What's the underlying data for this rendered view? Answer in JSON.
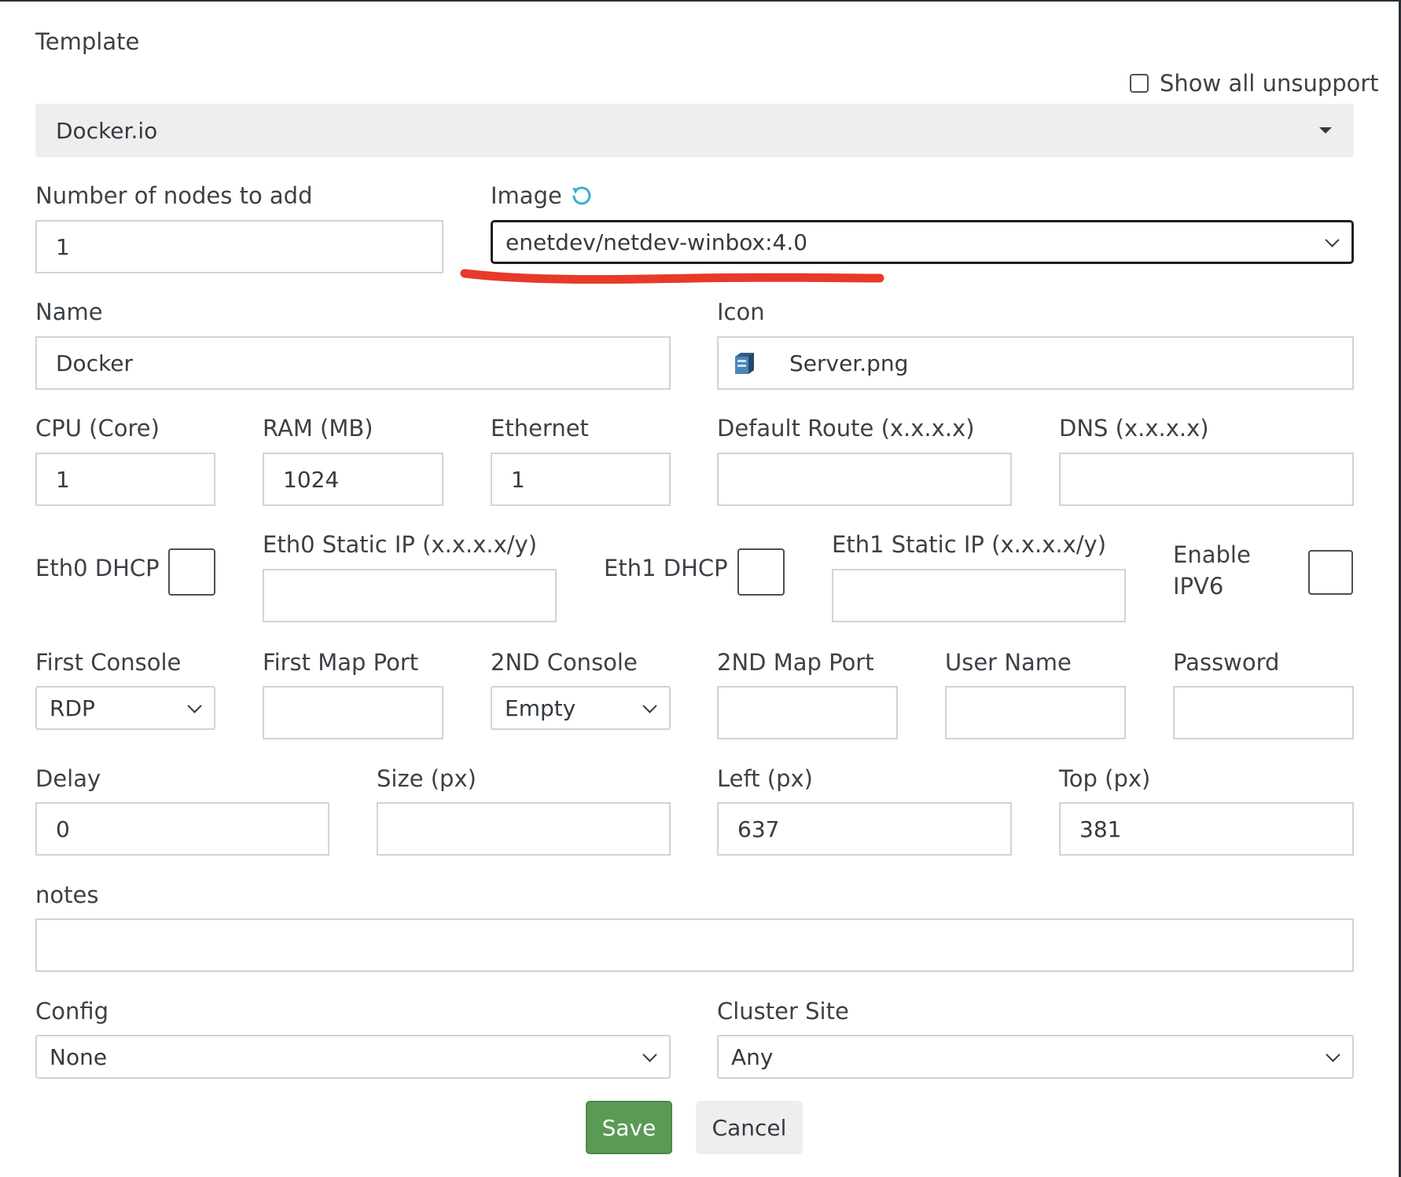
{
  "template": {
    "label": "Template",
    "value": "Docker.io",
    "show_all_label": "Show all unsupport"
  },
  "nodes": {
    "label": "Number of nodes to add",
    "value": "1"
  },
  "image": {
    "label": "Image",
    "value": "enetdev/netdev-winbox:4.0",
    "refresh_icon": "refresh-icon"
  },
  "name": {
    "label": "Name",
    "value": "Docker"
  },
  "icon": {
    "label": "Icon",
    "value": "Server.png",
    "glyph": "server-icon"
  },
  "cpu": {
    "label": "CPU (Core)",
    "value": "1"
  },
  "ram": {
    "label": "RAM (MB)",
    "value": "1024"
  },
  "ethernet": {
    "label": "Ethernet",
    "value": "1"
  },
  "default_route": {
    "label": "Default Route (x.x.x.x)",
    "value": ""
  },
  "dns": {
    "label": "DNS (x.x.x.x)",
    "value": ""
  },
  "eth0_dhcp": {
    "label": "Eth0 DHCP"
  },
  "eth0_ip": {
    "label": "Eth0 Static IP (x.x.x.x/y)",
    "value": ""
  },
  "eth1_dhcp": {
    "label": "Eth1 DHCP"
  },
  "eth1_ip": {
    "label": "Eth1 Static IP (x.x.x.x/y)",
    "value": ""
  },
  "ipv6": {
    "label_line1": "Enable",
    "label_line2": "IPV6"
  },
  "first_console": {
    "label": "First Console",
    "value": "RDP"
  },
  "first_map_port": {
    "label": "First Map Port",
    "value": ""
  },
  "second_console": {
    "label": "2ND Console",
    "value": "Empty"
  },
  "second_map_port": {
    "label": "2ND Map Port",
    "value": ""
  },
  "username": {
    "label": "User Name",
    "value": ""
  },
  "password": {
    "label": "Password",
    "value": ""
  },
  "delay": {
    "label": "Delay",
    "value": "0"
  },
  "size": {
    "label": "Size (px)",
    "value": ""
  },
  "left": {
    "label": "Left (px)",
    "value": "637"
  },
  "top": {
    "label": "Top (px)",
    "value": "381"
  },
  "notes": {
    "label": "notes",
    "value": ""
  },
  "config": {
    "label": "Config",
    "value": "None"
  },
  "cluster": {
    "label": "Cluster Site",
    "value": "Any"
  },
  "buttons": {
    "save": "Save",
    "cancel": "Cancel"
  },
  "colors": {
    "save_bg": "#5b9a55",
    "cancel_bg": "#eeeeee",
    "annotation_red": "#e8392a",
    "refresh_icon": "#3aaed0"
  }
}
